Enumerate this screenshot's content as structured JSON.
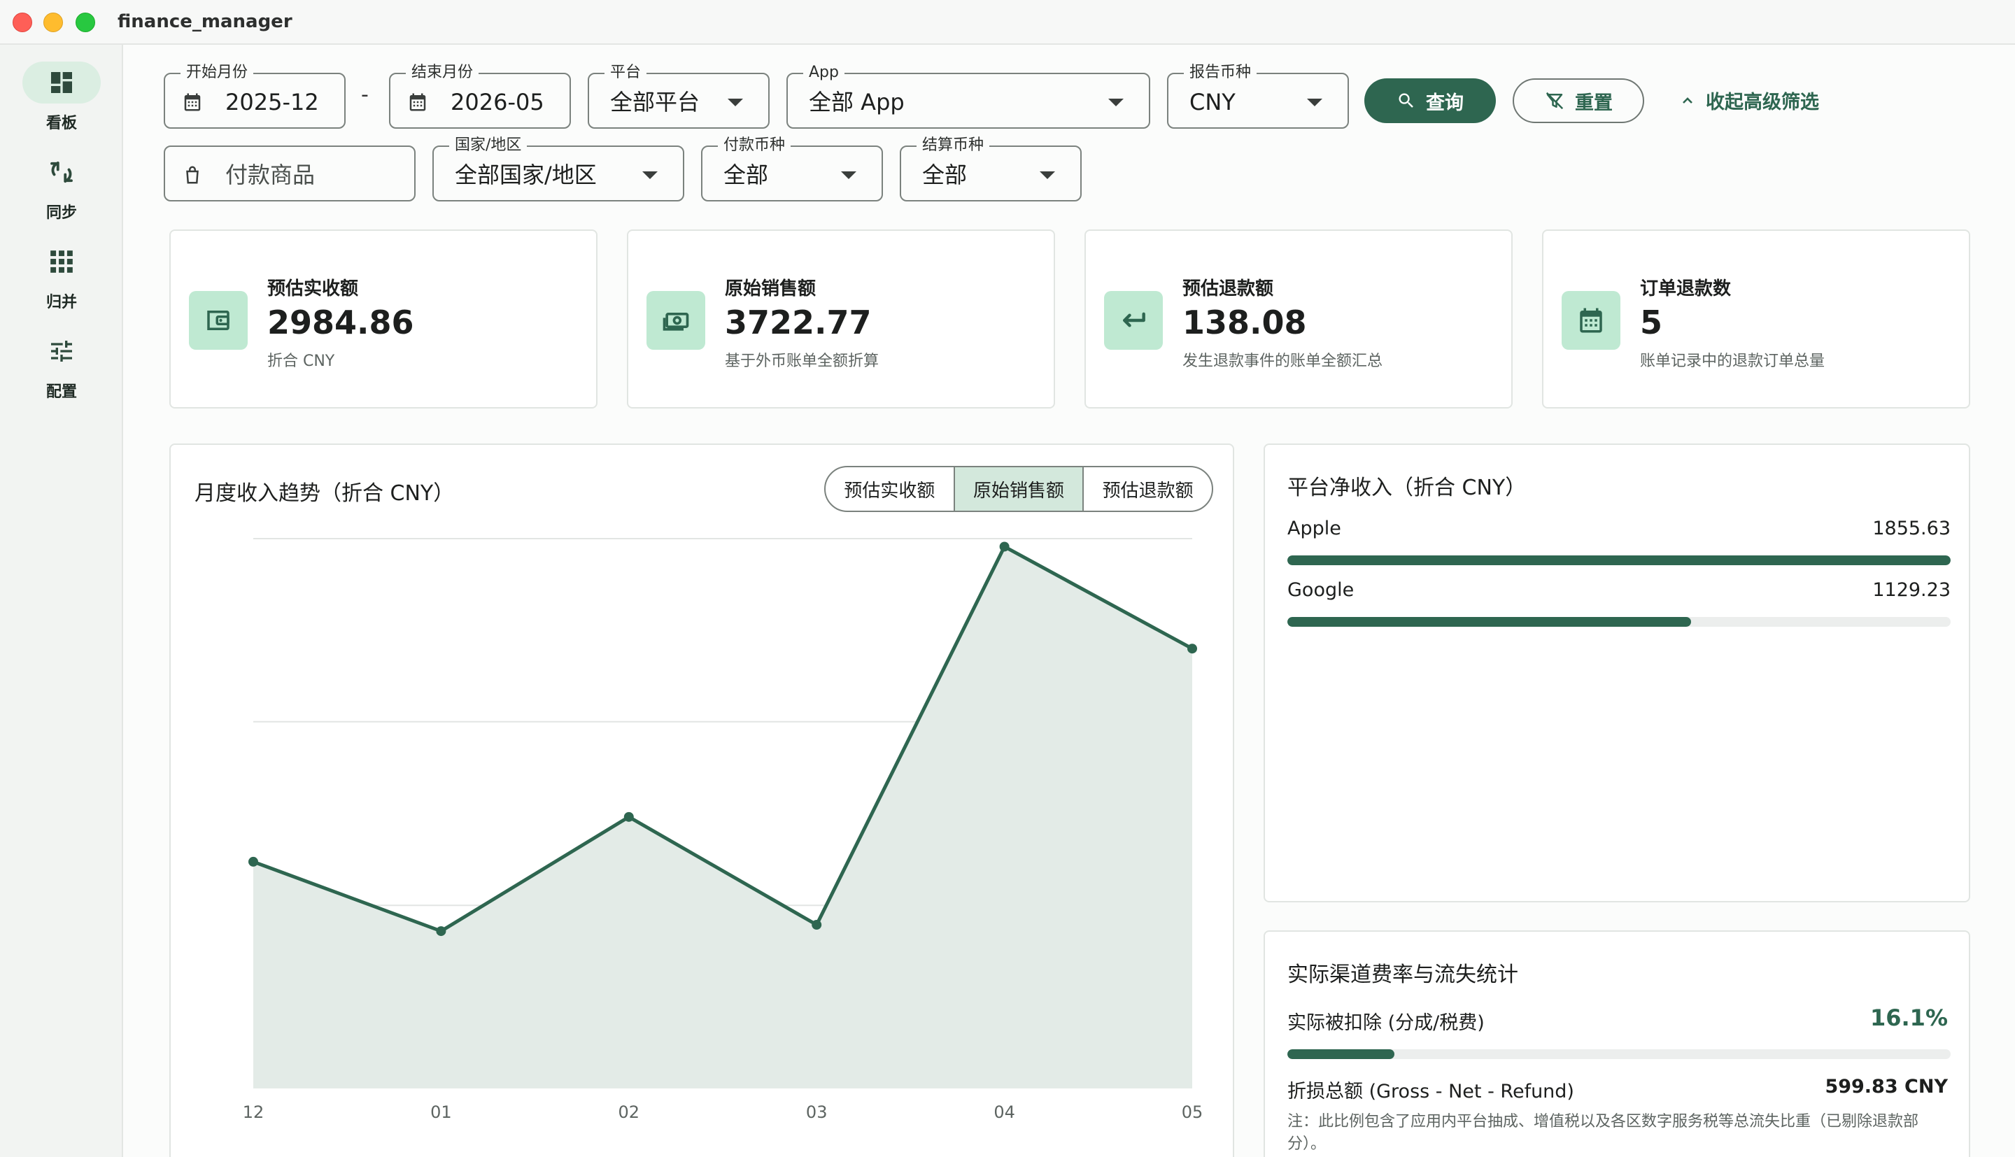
{
  "window": {
    "title": "finance_manager"
  },
  "sidebar": {
    "items": [
      {
        "label": "看板",
        "icon": "dashboard-icon",
        "active": true
      },
      {
        "label": "同步",
        "icon": "sync-icon",
        "active": false
      },
      {
        "label": "归并",
        "icon": "grid-icon",
        "active": false
      },
      {
        "label": "配置",
        "icon": "tune-icon",
        "active": false
      }
    ]
  },
  "filters": {
    "start_month": {
      "label": "开始月份",
      "value": "2025-12"
    },
    "separator": "-",
    "end_month": {
      "label": "结束月份",
      "value": "2026-05"
    },
    "platform": {
      "label": "平台",
      "value": "全部平台"
    },
    "app": {
      "label": "App",
      "value": "全部 App"
    },
    "report_currency": {
      "label": "报告币种",
      "value": "CNY"
    },
    "query_button": "查询",
    "reset_button": "重置",
    "collapse_link": "收起高级筛选",
    "product": {
      "placeholder": "付款商品"
    },
    "country": {
      "label": "国家/地区",
      "value": "全部国家/地区"
    },
    "pay_currency": {
      "label": "付款币种",
      "value": "全部"
    },
    "settle_currency": {
      "label": "结算币种",
      "value": "全部"
    }
  },
  "stats": [
    {
      "title": "预估实收额",
      "value": "2984.86",
      "sub": "折合 CNY",
      "icon": "wallet-icon"
    },
    {
      "title": "原始销售额",
      "value": "3722.77",
      "sub": "基于外币账单全额折算",
      "icon": "cash-icon"
    },
    {
      "title": "预估退款额",
      "value": "138.08",
      "sub": "发生退款事件的账单全额汇总",
      "icon": "return-arrow-icon"
    },
    {
      "title": "订单退款数",
      "value": "5",
      "sub": "账单记录中的退款订单总量",
      "icon": "calendar-icon"
    }
  ],
  "trend": {
    "title": "月度收入趋势（折合 CNY）",
    "tabs": [
      {
        "label": "预估实收额",
        "active": false
      },
      {
        "label": "原始销售额",
        "active": true
      },
      {
        "label": "预估退款额",
        "active": false
      }
    ]
  },
  "chart_data": {
    "type": "area",
    "title": "月度收入趋势（折合 CNY）",
    "categories": [
      "12",
      "01",
      "02",
      "03",
      "04",
      "05"
    ],
    "series": [
      {
        "name": "原始销售额",
        "values": [
          536,
          372,
          642,
          387,
          1281,
          1040
        ]
      }
    ],
    "ylim": [
      0,
      1300
    ],
    "grid": true,
    "line_color": "#2e6650",
    "fill_color": "#e3ebe7"
  },
  "platform_income": {
    "title": "平台净收入（折合 CNY）",
    "rows": [
      {
        "name": "Apple",
        "value": "1855.63",
        "fraction": 1.0
      },
      {
        "name": "Google",
        "value": "1129.23",
        "fraction": 0.6085
      }
    ]
  },
  "fee_stats": {
    "title": "实际渠道费率与流失统计",
    "deduct_label": "实际被扣除 (分成/税费)",
    "deduct_pct": "16.1%",
    "deduct_fraction": 0.161,
    "loss_label": "折损总额 (Gross - Net - Refund)",
    "loss_value": "599.83 CNY",
    "note": "注：此比例包含了应用内平台抽成、增值税以及各区数字服务税等总流失比重（已剔除退款部分）。"
  },
  "colors": {
    "accent": "#2e6650",
    "accent_light": "#bfe9d2",
    "active_nav": "#dbeee2"
  }
}
